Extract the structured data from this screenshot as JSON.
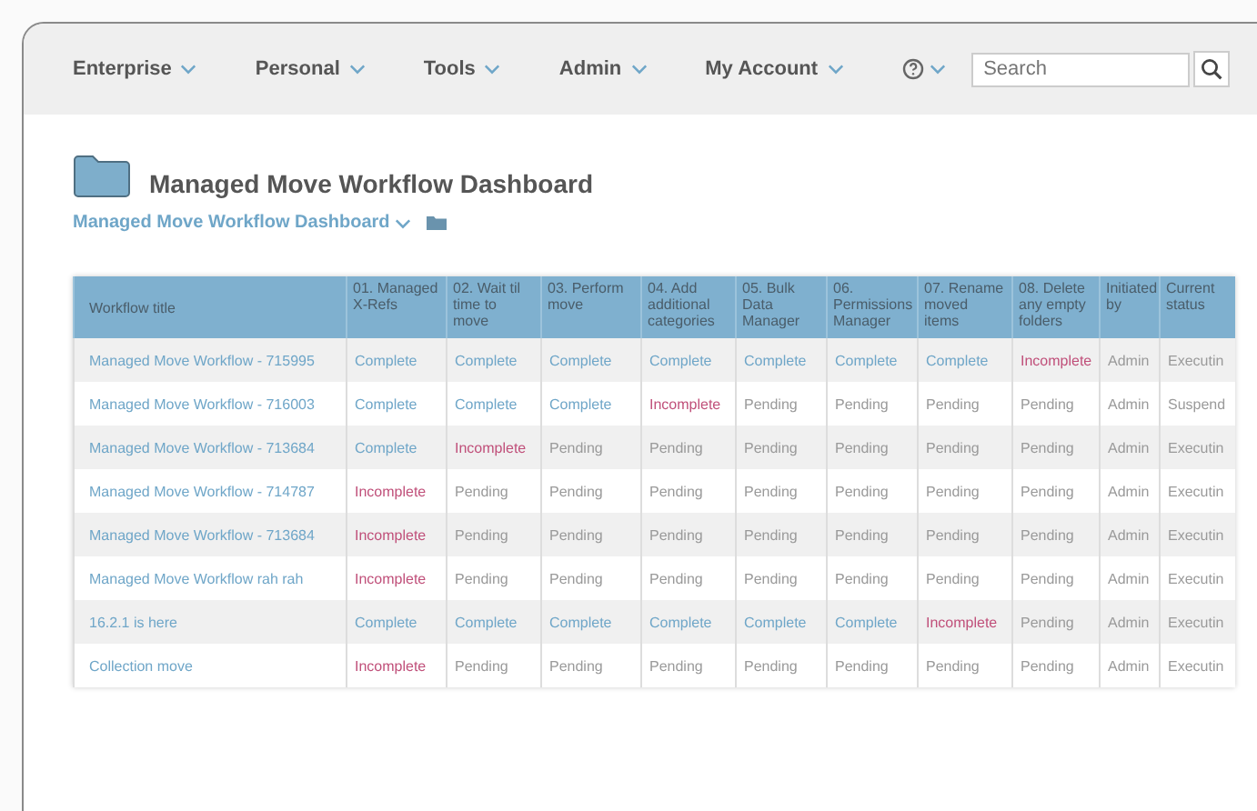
{
  "nav": {
    "items": [
      {
        "label": "Enterprise"
      },
      {
        "label": "Personal"
      },
      {
        "label": "Tools"
      },
      {
        "label": "Admin"
      },
      {
        "label": "My Account"
      }
    ],
    "search": {
      "placeholder": "Search"
    }
  },
  "page": {
    "title": "Managed Move Workflow Dashboard",
    "breadcrumb": "Managed Move Workflow Dashboard"
  },
  "table": {
    "columns": [
      "Workflow title",
      "01. Managed X-Refs",
      "02. Wait til time to move",
      "03. Perform move",
      "04. Add additional categories",
      "05. Bulk Data Manager",
      "06. Permissions Manager",
      "07. Rename moved items",
      "08. Delete any empty folders",
      "Initiated by",
      "Current status"
    ],
    "rows": [
      {
        "cells": [
          {
            "text": "Managed Move Workflow - 715995",
            "kind": "link"
          },
          {
            "text": "Complete",
            "kind": "complete"
          },
          {
            "text": "Complete",
            "kind": "complete"
          },
          {
            "text": "Complete",
            "kind": "complete"
          },
          {
            "text": "Complete",
            "kind": "complete"
          },
          {
            "text": "Complete",
            "kind": "complete"
          },
          {
            "text": "Complete",
            "kind": "complete"
          },
          {
            "text": "Complete",
            "kind": "complete"
          },
          {
            "text": "Incomplete",
            "kind": "incomplete"
          },
          {
            "text": "Admin",
            "kind": "pending"
          },
          {
            "text": "Executin",
            "kind": "pending"
          }
        ]
      },
      {
        "cells": [
          {
            "text": "Managed Move Workflow - 716003",
            "kind": "link"
          },
          {
            "text": "Complete",
            "kind": "complete"
          },
          {
            "text": "Complete",
            "kind": "complete"
          },
          {
            "text": "Complete",
            "kind": "complete"
          },
          {
            "text": "Incomplete",
            "kind": "incomplete"
          },
          {
            "text": "Pending",
            "kind": "pending"
          },
          {
            "text": "Pending",
            "kind": "pending"
          },
          {
            "text": "Pending",
            "kind": "pending"
          },
          {
            "text": "Pending",
            "kind": "pending"
          },
          {
            "text": "Admin",
            "kind": "pending"
          },
          {
            "text": "Suspend",
            "kind": "pending"
          }
        ]
      },
      {
        "cells": [
          {
            "text": "Managed Move Workflow - 713684",
            "kind": "link"
          },
          {
            "text": "Complete",
            "kind": "complete"
          },
          {
            "text": "Incomplete",
            "kind": "incomplete"
          },
          {
            "text": "Pending",
            "kind": "pending"
          },
          {
            "text": "Pending",
            "kind": "pending"
          },
          {
            "text": "Pending",
            "kind": "pending"
          },
          {
            "text": "Pending",
            "kind": "pending"
          },
          {
            "text": "Pending",
            "kind": "pending"
          },
          {
            "text": "Pending",
            "kind": "pending"
          },
          {
            "text": "Admin",
            "kind": "pending"
          },
          {
            "text": "Executin",
            "kind": "pending"
          }
        ]
      },
      {
        "cells": [
          {
            "text": "Managed Move Workflow - 714787",
            "kind": "link"
          },
          {
            "text": "Incomplete",
            "kind": "incomplete"
          },
          {
            "text": "Pending",
            "kind": "pending"
          },
          {
            "text": "Pending",
            "kind": "pending"
          },
          {
            "text": "Pending",
            "kind": "pending"
          },
          {
            "text": "Pending",
            "kind": "pending"
          },
          {
            "text": "Pending",
            "kind": "pending"
          },
          {
            "text": "Pending",
            "kind": "pending"
          },
          {
            "text": "Pending",
            "kind": "pending"
          },
          {
            "text": "Admin",
            "kind": "pending"
          },
          {
            "text": "Executin",
            "kind": "pending"
          }
        ]
      },
      {
        "cells": [
          {
            "text": "Managed Move Workflow - 713684",
            "kind": "link"
          },
          {
            "text": "Incomplete",
            "kind": "incomplete"
          },
          {
            "text": "Pending",
            "kind": "pending"
          },
          {
            "text": "Pending",
            "kind": "pending"
          },
          {
            "text": "Pending",
            "kind": "pending"
          },
          {
            "text": "Pending",
            "kind": "pending"
          },
          {
            "text": "Pending",
            "kind": "pending"
          },
          {
            "text": "Pending",
            "kind": "pending"
          },
          {
            "text": "Pending",
            "kind": "pending"
          },
          {
            "text": "Admin",
            "kind": "pending"
          },
          {
            "text": "Executin",
            "kind": "pending"
          }
        ]
      },
      {
        "cells": [
          {
            "text": "Managed Move Workflow rah rah",
            "kind": "link"
          },
          {
            "text": "Incomplete",
            "kind": "incomplete"
          },
          {
            "text": "Pending",
            "kind": "pending"
          },
          {
            "text": "Pending",
            "kind": "pending"
          },
          {
            "text": "Pending",
            "kind": "pending"
          },
          {
            "text": "Pending",
            "kind": "pending"
          },
          {
            "text": "Pending",
            "kind": "pending"
          },
          {
            "text": "Pending",
            "kind": "pending"
          },
          {
            "text": "Pending",
            "kind": "pending"
          },
          {
            "text": "Admin",
            "kind": "pending"
          },
          {
            "text": "Executin",
            "kind": "pending"
          }
        ]
      },
      {
        "cells": [
          {
            "text": "16.2.1 is here",
            "kind": "link"
          },
          {
            "text": "Complete",
            "kind": "complete"
          },
          {
            "text": "Complete",
            "kind": "complete"
          },
          {
            "text": "Complete",
            "kind": "complete"
          },
          {
            "text": "Complete",
            "kind": "complete"
          },
          {
            "text": "Complete",
            "kind": "complete"
          },
          {
            "text": "Complete",
            "kind": "complete"
          },
          {
            "text": "Incomplete",
            "kind": "incomplete"
          },
          {
            "text": "Pending",
            "kind": "pending"
          },
          {
            "text": "Admin",
            "kind": "pending"
          },
          {
            "text": "Executin",
            "kind": "pending"
          }
        ]
      },
      {
        "cells": [
          {
            "text": "Collection move",
            "kind": "link"
          },
          {
            "text": "Incomplete",
            "kind": "incomplete"
          },
          {
            "text": "Pending",
            "kind": "pending"
          },
          {
            "text": "Pending",
            "kind": "pending"
          },
          {
            "text": "Pending",
            "kind": "pending"
          },
          {
            "text": "Pending",
            "kind": "pending"
          },
          {
            "text": "Pending",
            "kind": "pending"
          },
          {
            "text": "Pending",
            "kind": "pending"
          },
          {
            "text": "Pending",
            "kind": "pending"
          },
          {
            "text": "Admin",
            "kind": "pending"
          },
          {
            "text": "Executin",
            "kind": "pending"
          }
        ]
      }
    ]
  }
}
